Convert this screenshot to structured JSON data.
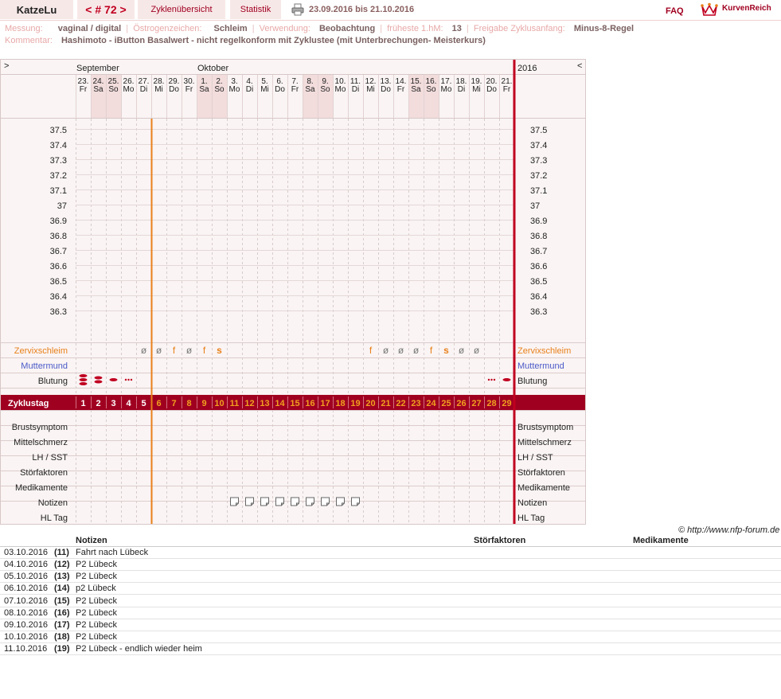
{
  "header": {
    "username": "KatzeLu",
    "cycle_label": "< # 72 >",
    "tabs": [
      "Zyklenübersicht",
      "Statistik"
    ],
    "date_range": "23.09.2016 bis 21.10.2016",
    "faq": "FAQ",
    "logo_text": "KurvenReich"
  },
  "meta": {
    "row1": [
      {
        "key": "Messung:",
        "value": "vaginal / digital"
      },
      {
        "key": "Östrogenzeichen:",
        "value": "Schleim"
      },
      {
        "key": "Verwendung:",
        "value": "Beobachtung"
      },
      {
        "key": "früheste 1.hM:",
        "value": "13"
      },
      {
        "key": "Freigabe Zyklusanfang:",
        "value": "Minus-8-Regel"
      }
    ],
    "comment_key": "Kommentar:",
    "comment_value": "Hashimoto - iButton Basalwert - nicht regelkonform mit Zyklustee (mit Unterbrechungen- Meisterkurs)"
  },
  "chart": {
    "nav_prev": ">",
    "nav_next": "<",
    "year": "2016",
    "months": [
      {
        "label": "September",
        "index": 0
      },
      {
        "label": "Oktober",
        "index": 8
      }
    ],
    "days": [
      "23.",
      "24.",
      "25.",
      "26.",
      "27.",
      "28.",
      "29.",
      "30.",
      "1.",
      "2.",
      "3.",
      "4.",
      "5.",
      "6.",
      "7.",
      "8.",
      "9.",
      "10.",
      "11.",
      "12.",
      "13.",
      "14.",
      "15.",
      "16.",
      "17.",
      "18.",
      "19.",
      "20.",
      "21."
    ],
    "weekdays": [
      "Fr",
      "Sa",
      "So",
      "Mo",
      "Di",
      "Mi",
      "Do",
      "Fr",
      "Sa",
      "So",
      "Mo",
      "Di",
      "Mi",
      "Do",
      "Fr",
      "Sa",
      "So",
      "Mo",
      "Di",
      "Mi",
      "Do",
      "Fr",
      "Sa",
      "So",
      "Mo",
      "Di",
      "Mi",
      "Do",
      "Fr"
    ],
    "weekend_indexes": [
      1,
      2,
      8,
      9,
      15,
      16,
      22,
      23
    ],
    "temp_labels": [
      "37.5",
      "37.4",
      "37.3",
      "37.2",
      "37.1",
      "37",
      "36.9",
      "36.8",
      "36.7",
      "36.6",
      "36.5",
      "36.4",
      "36.3"
    ],
    "coverline_after_index": 4,
    "cycle_day_label": "Zyklustag",
    "cycle_days": [
      "1",
      "2",
      "3",
      "4",
      "5",
      "6",
      "7",
      "8",
      "9",
      "10",
      "11",
      "12",
      "13",
      "14",
      "15",
      "16",
      "17",
      "18",
      "19",
      "20",
      "21",
      "22",
      "23",
      "24",
      "25",
      "26",
      "27",
      "28",
      "29"
    ],
    "rows": {
      "cervix": "Zervixschleim",
      "mouth": "Muttermund",
      "bleeding": "Blutung",
      "breast": "Brustsymptom",
      "midpain": "Mittelschmerz",
      "lh": "LH / SST",
      "disturb": "Störfaktoren",
      "meds": "Medikamente",
      "notes": "Notizen",
      "hl": "HL Tag"
    },
    "cervix_marks": [
      "",
      "",
      "",
      "",
      "ø",
      "ø",
      "f",
      "ø",
      "f",
      "s",
      "",
      "",
      "",
      "",
      "",
      "",
      "",
      "",
      "",
      "f",
      "ø",
      "ø",
      "ø",
      "f",
      "s",
      "ø",
      "ø",
      "",
      ""
    ],
    "bleeding_levels": [
      3,
      2,
      1,
      0.5,
      0,
      0,
      0,
      0,
      0,
      0,
      0,
      0,
      0,
      0,
      0,
      0,
      0,
      0,
      0,
      0,
      0,
      0,
      0,
      0,
      0,
      0,
      0,
      0.5,
      1
    ],
    "note_days": [
      10,
      11,
      12,
      13,
      14,
      15,
      16,
      17,
      18
    ],
    "colors": {
      "accent": "#a00020",
      "orange": "#e8801a",
      "blue": "#4a5ac8",
      "weekend": "#f2dcdc"
    }
  },
  "copyright": "© http://www.nfp-forum.de",
  "notes_table": {
    "headers": [
      "Notizen",
      "Störfaktoren",
      "Medikamente"
    ],
    "rows": [
      {
        "date": "03.10.2016",
        "day": "(11)",
        "note": "Fahrt nach Lübeck"
      },
      {
        "date": "04.10.2016",
        "day": "(12)",
        "note": "P2 Lübeck"
      },
      {
        "date": "05.10.2016",
        "day": "(13)",
        "note": "P2 Lübeck"
      },
      {
        "date": "06.10.2016",
        "day": "(14)",
        "note": "p2 Lübeck"
      },
      {
        "date": "07.10.2016",
        "day": "(15)",
        "note": "P2 Lübeck"
      },
      {
        "date": "08.10.2016",
        "day": "(16)",
        "note": "P2 Lübeck"
      },
      {
        "date": "09.10.2016",
        "day": "(17)",
        "note": "P2 Lübeck"
      },
      {
        "date": "10.10.2016",
        "day": "(18)",
        "note": "P2 Lübeck"
      },
      {
        "date": "11.10.2016",
        "day": "(19)",
        "note": "P2 Lübeck - endlich wieder heim"
      }
    ]
  }
}
